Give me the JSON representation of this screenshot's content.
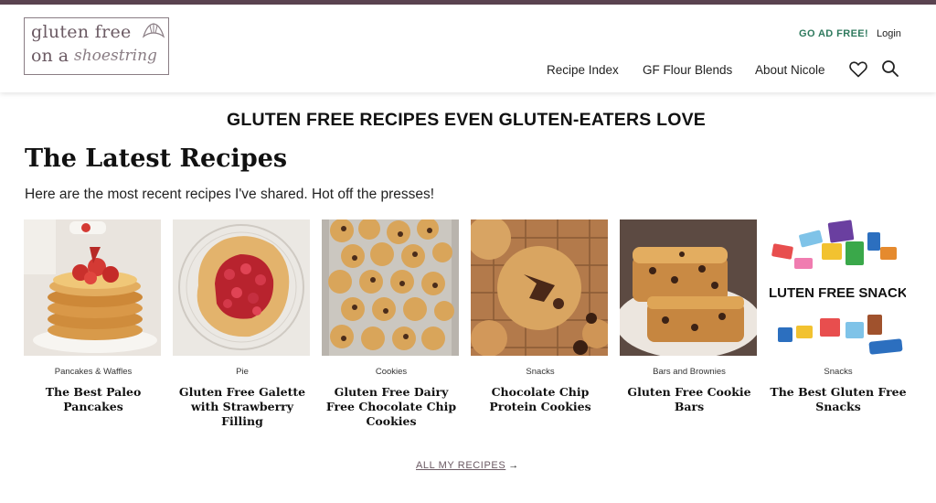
{
  "header": {
    "logo": {
      "line1": "gluten free",
      "line2": "on a",
      "script": "shoestring"
    },
    "go_ad_free": "GO AD FREE!",
    "login": "Login",
    "nav": [
      "Recipe Index",
      "GF Flour Blends",
      "About Nicole"
    ],
    "icons": [
      "heart-icon",
      "search-icon"
    ]
  },
  "tagline": "GLUTEN FREE RECIPES EVEN GLUTEN-EATERS LOVE",
  "latest": {
    "title": "The Latest Recipes",
    "intro": "Here are the most recent recipes I've shared. Hot off the presses!",
    "cards": [
      {
        "category": "Pancakes & Waffles",
        "title": "The Best Paleo Pancakes"
      },
      {
        "category": "Pie",
        "title": "Gluten Free Galette with Strawberry Filling"
      },
      {
        "category": "Cookies",
        "title": "Gluten Free Dairy Free Chocolate Chip Cookies"
      },
      {
        "category": "Snacks",
        "title": "Chocolate Chip Protein Cookies"
      },
      {
        "category": "Bars and Brownies",
        "title": "Gluten Free Cookie Bars"
      },
      {
        "category": "Snacks",
        "title": "The Best Gluten Free Snacks",
        "image_text": "GLUTEN FREE SNACKS"
      }
    ],
    "all_link": "ALL MY RECIPES",
    "arrow": "→"
  },
  "colors": {
    "brand": "#5b4350",
    "accent_green": "#2f7a5e",
    "logo": "#6b5a63"
  }
}
